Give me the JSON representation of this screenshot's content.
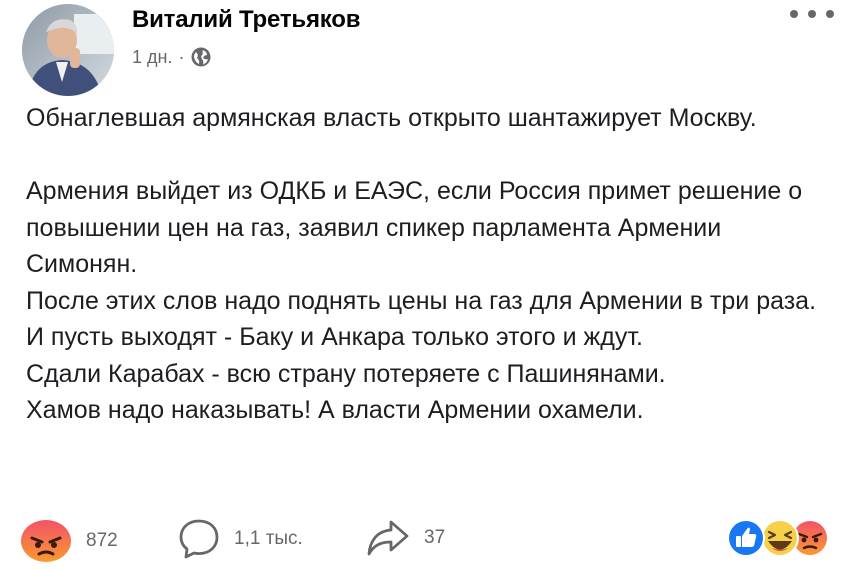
{
  "post": {
    "author": "Виталий Третьяков",
    "time": "1 дн.",
    "separator": "·",
    "privacy_icon": "globe-icon",
    "more_icon": "more-options-icon",
    "paragraphs": [
      "Обнаглевшая армянская власть открыто шантажирует Москву.",
      "",
      "Армения выйдет из ОДКБ и ЕАЭС, если Россия примет решение о повышении цен на газ, заявил спикер парламента Армении Симонян.",
      "После этих слов надо поднять цены на газ для Армении в три раза. И пусть выходят - Баку и Анкара только этого и ждут.",
      "Сдали Карабах - всю страну потеряете с Пашинянами.",
      "Хамов надо наказывать! А власти Армении охамели."
    ]
  },
  "actions": {
    "reaction_count": "872",
    "comment_count": "1,1 тыс.",
    "share_count": "37"
  },
  "reactions_summary": [
    "like",
    "haha",
    "angry"
  ],
  "colors": {
    "angry_gradient_top": "#f25268",
    "angry_gradient_bottom": "#f99a2e",
    "like_blue": "#1877f2",
    "haha_yellow": "#f7d04a",
    "muted_text": "#65676b"
  }
}
